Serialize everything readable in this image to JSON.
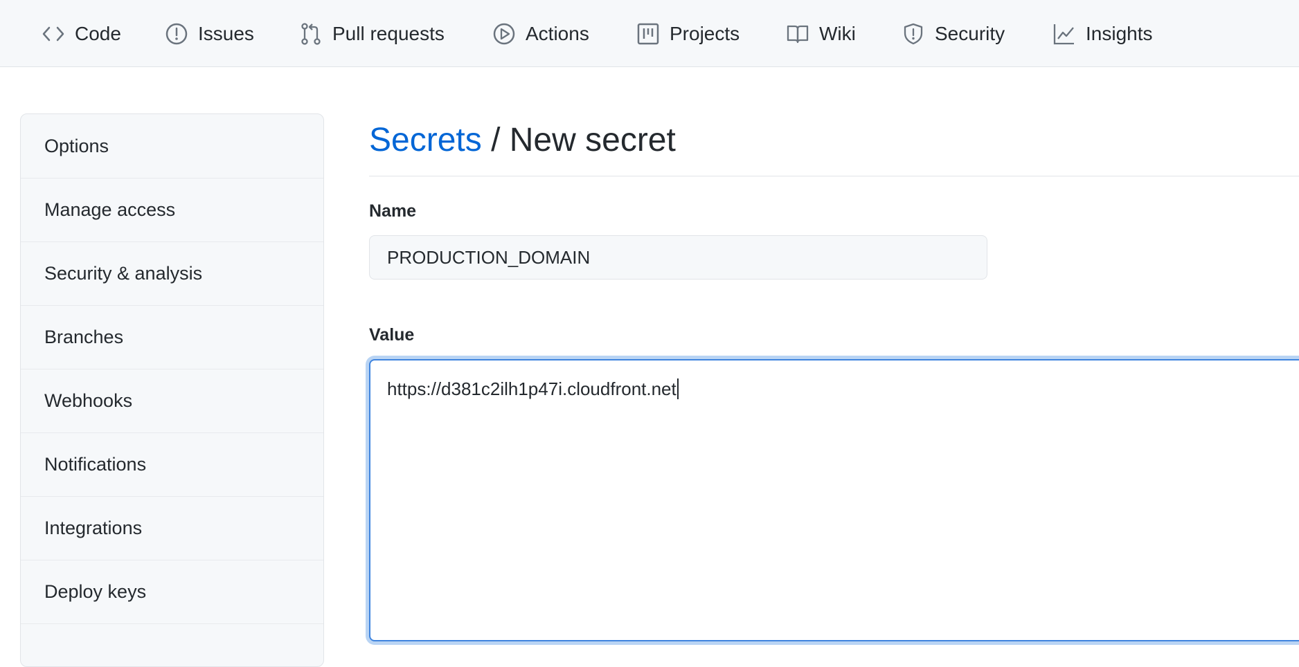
{
  "nav": {
    "tabs": [
      {
        "label": "Code",
        "icon": "code-icon"
      },
      {
        "label": "Issues",
        "icon": "issue-icon"
      },
      {
        "label": "Pull requests",
        "icon": "pull-request-icon"
      },
      {
        "label": "Actions",
        "icon": "play-icon"
      },
      {
        "label": "Projects",
        "icon": "project-icon"
      },
      {
        "label": "Wiki",
        "icon": "book-icon"
      },
      {
        "label": "Security",
        "icon": "shield-icon"
      },
      {
        "label": "Insights",
        "icon": "graph-icon"
      }
    ]
  },
  "sidebar": {
    "items": [
      {
        "label": "Options"
      },
      {
        "label": "Manage access"
      },
      {
        "label": "Security & analysis"
      },
      {
        "label": "Branches"
      },
      {
        "label": "Webhooks"
      },
      {
        "label": "Notifications"
      },
      {
        "label": "Integrations"
      },
      {
        "label": "Deploy keys"
      }
    ]
  },
  "main": {
    "breadcrumb_link": "Secrets",
    "breadcrumb_separator": "/",
    "breadcrumb_current": "New secret",
    "name_label": "Name",
    "name_value": "PRODUCTION_DOMAIN",
    "value_label": "Value",
    "value_text": "https://d381c2ilh1p47i.cloudfront.net"
  },
  "colors": {
    "accent": "#0366d6",
    "focus_border": "#3f84de",
    "nav_background": "#f6f8fa",
    "text": "#24292e"
  }
}
